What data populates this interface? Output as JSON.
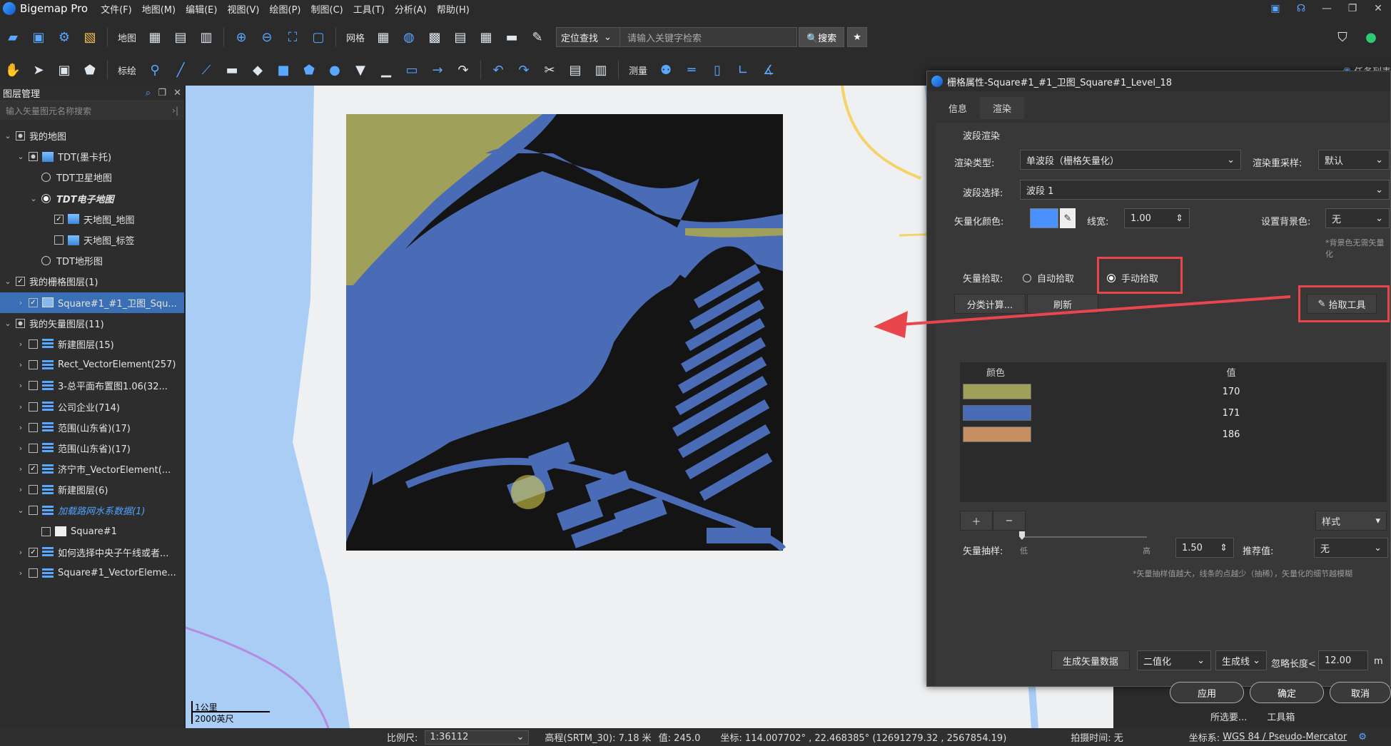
{
  "app": {
    "title": "Bigemap Pro",
    "menus": [
      "文件(F)",
      "地图(M)",
      "编辑(E)",
      "视图(V)",
      "绘图(P)",
      "制图(C)",
      "工具(T)",
      "分析(A)",
      "帮助(H)"
    ],
    "window_controls": [
      "—",
      "❐",
      "✕"
    ]
  },
  "toolbar1": {
    "map_label": "地图",
    "grid_label": "网格",
    "locate_label": "定位查找",
    "search_placeholder": "请输入关键字检索",
    "search_button": "🔍搜索"
  },
  "toolbar2": {
    "annotate_label": "标绘",
    "measure_label": "测量"
  },
  "layer_panel": {
    "title": "图层管理",
    "filter_placeholder": "输入矢量图元名称搜索",
    "items": [
      {
        "label": "我的地图",
        "arrow": "⌄",
        "ctl": "chk-part",
        "icon": "",
        "indent": 0
      },
      {
        "label": "TDT(墨卡托)",
        "arrow": "⌄",
        "ctl": "chk-part",
        "icon": "map",
        "indent": 1
      },
      {
        "label": "TDT卫星地图",
        "arrow": "",
        "ctl": "radio",
        "icon": "",
        "indent": 2
      },
      {
        "label": "TDT电子地图",
        "arrow": "⌄",
        "ctl": "radio-on",
        "icon": "",
        "indent": 2,
        "style": "italic"
      },
      {
        "label": "天地图_地图",
        "arrow": "",
        "ctl": "chk-on",
        "icon": "map",
        "indent": 3
      },
      {
        "label": "天地图_标签",
        "arrow": "",
        "ctl": "chk",
        "icon": "map",
        "indent": 3
      },
      {
        "label": "TDT地形图",
        "arrow": "",
        "ctl": "radio",
        "icon": "",
        "indent": 2
      },
      {
        "label": "我的栅格图层(1)",
        "arrow": "⌄",
        "ctl": "chk-on",
        "icon": "",
        "indent": 0
      },
      {
        "label": "Square#1_#1_卫图_Squ...",
        "arrow": "›",
        "ctl": "chk-on",
        "icon": "img",
        "indent": 1,
        "selected": true
      },
      {
        "label": "我的矢量图层(11)",
        "arrow": "⌄",
        "ctl": "chk-part",
        "icon": "",
        "indent": 0
      },
      {
        "label": "新建图层(15)",
        "arrow": "›",
        "ctl": "chk",
        "icon": "stack",
        "indent": 1
      },
      {
        "label": "Rect_VectorElement(257)",
        "arrow": "›",
        "ctl": "chk",
        "icon": "stack",
        "indent": 1
      },
      {
        "label": "3-总平面布置图1.06(32...",
        "arrow": "›",
        "ctl": "chk",
        "icon": "stack",
        "indent": 1
      },
      {
        "label": "公司企业(714)",
        "arrow": "›",
        "ctl": "chk",
        "icon": "stack",
        "indent": 1
      },
      {
        "label": "范围(山东省)(17)",
        "arrow": "›",
        "ctl": "chk",
        "icon": "stack",
        "indent": 1
      },
      {
        "label": "范围(山东省)(17)",
        "arrow": "›",
        "ctl": "chk",
        "icon": "stack",
        "indent": 1
      },
      {
        "label": "济宁市_VectorElement(...",
        "arrow": "›",
        "ctl": "chk-on",
        "icon": "stack",
        "indent": 1
      },
      {
        "label": "新建图层(6)",
        "arrow": "›",
        "ctl": "chk",
        "icon": "stack",
        "indent": 1
      },
      {
        "label": "加载路网水系数据(1)",
        "arrow": "⌄",
        "ctl": "chk",
        "icon": "stack",
        "indent": 1,
        "style": "blue"
      },
      {
        "label": "Square#1",
        "arrow": "",
        "ctl": "chk",
        "icon": "white",
        "indent": 2
      },
      {
        "label": "如何选择中央子午线或者...",
        "arrow": "›",
        "ctl": "chk-on",
        "icon": "stack",
        "indent": 1
      },
      {
        "label": "Square#1_VectorEleme...",
        "arrow": "›",
        "ctl": "chk",
        "icon": "stack",
        "indent": 1
      }
    ]
  },
  "map": {
    "scale_km": "1公里",
    "scale_ft": "2000英尺",
    "colors": {
      "water": "#4a6bb5",
      "land": "#9fa05a",
      "dark": "#141414",
      "sea": "#a9cdf5"
    }
  },
  "dialog": {
    "title": "栅格属性-Square#1_#1_卫图_Square#1_Level_18",
    "tabs": [
      "信息",
      "渲染"
    ],
    "active_tab": "渲染",
    "section_title": "波段渲染",
    "render_type_label": "渲染类型:",
    "render_type_value": "单波段（栅格矢量化）",
    "resample_label": "渲染重采样:",
    "resample_value": "默认",
    "band_label": "波段选择:",
    "band_value": "波段 1",
    "vector_color_label": "矢量化颜色:",
    "vector_color": "#4a90ff",
    "line_width_label": "线宽:",
    "line_width_value": "1.00",
    "bg_label": "设置背景色:",
    "bg_value": "无",
    "bg_note": "*背景色无需矢量化",
    "pick_label": "矢量拾取:",
    "auto_pick": "自动拾取",
    "manual_pick": "手动拾取",
    "classify_button": "分类计算...",
    "refresh_button": "刷新",
    "pick_tool_button": "拾取工具",
    "table_header_color": "颜色",
    "table_header_value": "值",
    "rows": [
      {
        "color": "#9fa05a",
        "value": "170"
      },
      {
        "color": "#4a6bb5",
        "value": "171"
      },
      {
        "color": "#c58f62",
        "value": "186"
      }
    ],
    "style_button": "样式",
    "sampling_label": "矢量抽样:",
    "sampling_low": "低",
    "sampling_high": "高",
    "sampling_value": "1.50",
    "recommend_label": "推荐值:",
    "recommend_value": "无",
    "sampling_note": "*矢量抽样值越大，线条的点越少（抽稀），矢量化的细节越模糊",
    "generate_button": "生成矢量数据",
    "binarize_value": "二值化",
    "genline_value": "生成线",
    "ignore_label": "忽略长度<",
    "ignore_value": "12.00",
    "ignore_unit": "m",
    "apply_button": "应用",
    "ok_button": "确定",
    "cancel_button": "取消"
  },
  "right_dock": {
    "tasklist": "任务列表",
    "bottom_tabs": [
      "所选要...",
      "工具箱"
    ]
  },
  "statusbar": {
    "scale_label": "比例尺:",
    "scale_value": "1:36112",
    "elevation": "高程(SRTM_30): 7.18 米",
    "value": "值: 245.0",
    "coords": "坐标: 114.007702° , 22.468385°  (12691279.32 , 2567854.19)",
    "capture_time": "拍摄时间: 无",
    "crs_label": "坐标系:",
    "crs_value": "WGS 84 / Pseudo-Mercator"
  }
}
